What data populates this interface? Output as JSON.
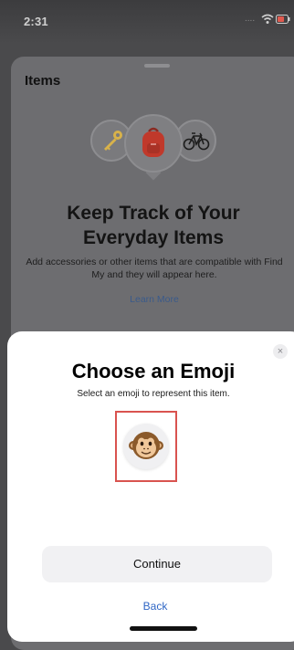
{
  "status_bar": {
    "time": "2:31",
    "signal_placeholder": "....",
    "icons": [
      "wifi-icon",
      "battery-icon"
    ]
  },
  "background_sheet": {
    "title": "Items",
    "item_icons": [
      "key-icon",
      "backpack-icon",
      "bicycle-icon"
    ],
    "headline": "Keep Track of Your Everyday Items",
    "body": "Add accessories or other items that are compatible with Find My and they will appear here.",
    "learn_more": "Learn More"
  },
  "modal": {
    "close_label": "×",
    "title": "Choose an Emoji",
    "subtitle": "Select an emoji to represent this item.",
    "selected_emoji": "monkey-face-icon",
    "continue_label": "Continue",
    "back_label": "Back"
  },
  "colors": {
    "accent_link": "#2f66c5",
    "selection_border": "#d9534f",
    "dim_overlay": "#6d6d70"
  }
}
